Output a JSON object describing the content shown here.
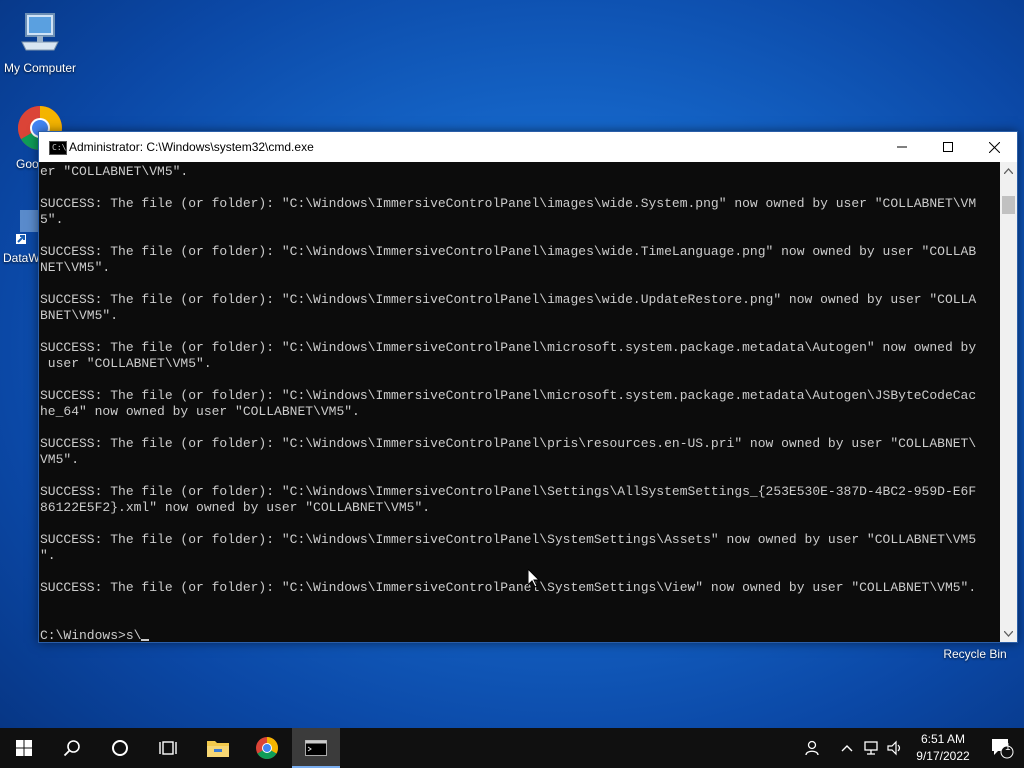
{
  "desktop": {
    "icons": [
      {
        "label": "My Computer"
      },
      {
        "label": "Goo Chro"
      },
      {
        "label": "DataW"
      },
      {
        "label": "Recycle Bin"
      }
    ]
  },
  "window": {
    "title": "Administrator: C:\\Windows\\system32\\cmd.exe",
    "console_lines": [
      "er \"COLLABNET\\VM5\".",
      "",
      "SUCCESS: The file (or folder): \"C:\\Windows\\ImmersiveControlPanel\\images\\wide.System.png\" now owned by user \"COLLABNET\\VM",
      "5\".",
      "",
      "SUCCESS: The file (or folder): \"C:\\Windows\\ImmersiveControlPanel\\images\\wide.TimeLanguage.png\" now owned by user \"COLLAB",
      "NET\\VM5\".",
      "",
      "SUCCESS: The file (or folder): \"C:\\Windows\\ImmersiveControlPanel\\images\\wide.UpdateRestore.png\" now owned by user \"COLLA",
      "BNET\\VM5\".",
      "",
      "SUCCESS: The file (or folder): \"C:\\Windows\\ImmersiveControlPanel\\microsoft.system.package.metadata\\Autogen\" now owned by",
      " user \"COLLABNET\\VM5\".",
      "",
      "SUCCESS: The file (or folder): \"C:\\Windows\\ImmersiveControlPanel\\microsoft.system.package.metadata\\Autogen\\JSByteCodeCac",
      "he_64\" now owned by user \"COLLABNET\\VM5\".",
      "",
      "SUCCESS: The file (or folder): \"C:\\Windows\\ImmersiveControlPanel\\pris\\resources.en-US.pri\" now owned by user \"COLLABNET\\",
      "VM5\".",
      "",
      "SUCCESS: The file (or folder): \"C:\\Windows\\ImmersiveControlPanel\\Settings\\AllSystemSettings_{253E530E-387D-4BC2-959D-E6F",
      "86122E5F2}.xml\" now owned by user \"COLLABNET\\VM5\".",
      "",
      "SUCCESS: The file (or folder): \"C:\\Windows\\ImmersiveControlPanel\\SystemSettings\\Assets\" now owned by user \"COLLABNET\\VM5",
      "\".",
      "",
      "SUCCESS: The file (or folder): \"C:\\Windows\\ImmersiveControlPanel\\SystemSettings\\View\" now owned by user \"COLLABNET\\VM5\".",
      "",
      ""
    ],
    "prompt": "C:\\Windows>s\\"
  },
  "taskbar": {
    "time": "6:51 AM",
    "date": "9/17/2022",
    "notification_count": "1"
  },
  "colors": {
    "console_bg": "#0c0c0c",
    "console_fg": "#cccccc",
    "taskbar_bg": "#101010"
  }
}
